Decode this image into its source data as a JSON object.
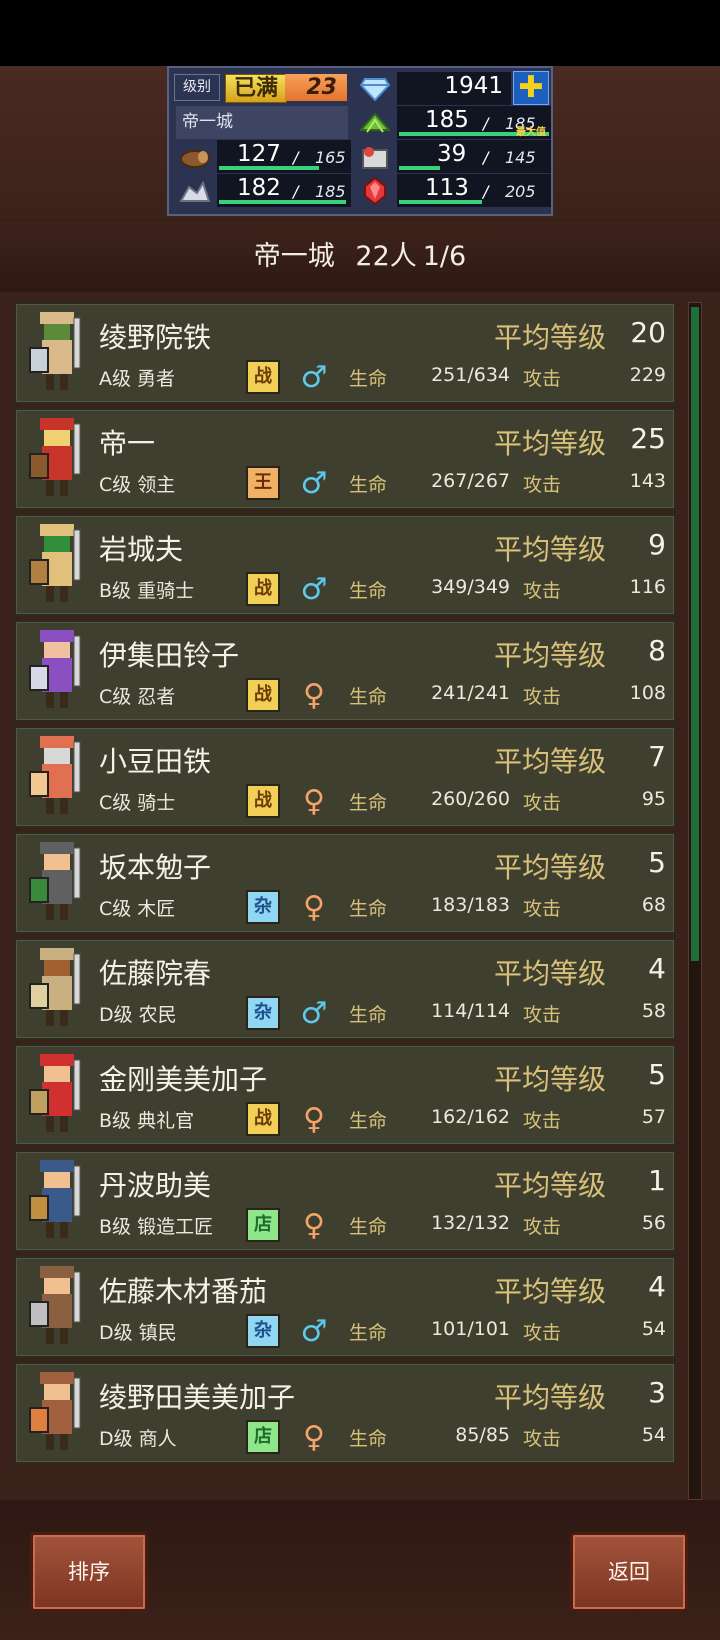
{
  "hud": {
    "level_label": "级别",
    "level_max": "已满",
    "level": "23",
    "gems": "1941",
    "city": "帝一城",
    "food": {
      "value": "185",
      "max": "185",
      "tag": "最大值",
      "fill": 1.0
    },
    "wood": {
      "value": "127",
      "max": "165",
      "fill": 0.77
    },
    "ore": {
      "value": "39",
      "max": "145",
      "fill": 0.27
    },
    "stone": {
      "value": "182",
      "max": "185",
      "fill": 0.98
    },
    "crystal": {
      "value": "113",
      "max": "205",
      "fill": 0.55
    },
    "sep": "/"
  },
  "title": {
    "city": "帝一城",
    "count": "22人",
    "page": "1/6"
  },
  "labels": {
    "avg": "平均等级",
    "hp": "生命",
    "atk": "攻击"
  },
  "units": [
    {
      "name": "绫野院铁",
      "avg": "20",
      "rank": "A级 勇者",
      "badge": "战",
      "badge_type": "zhan",
      "gender": "male",
      "hp": "251/634",
      "atk": "229"
    },
    {
      "name": "帝一",
      "avg": "25",
      "rank": "C级 领主",
      "badge": "王",
      "badge_type": "wang",
      "gender": "male",
      "hp": "267/267",
      "atk": "143"
    },
    {
      "name": "岩城夫",
      "avg": "9",
      "rank": "B级 重骑士",
      "badge": "战",
      "badge_type": "zhan",
      "gender": "male",
      "hp": "349/349",
      "atk": "116"
    },
    {
      "name": "伊集田铃子",
      "avg": "8",
      "rank": "C级 忍者",
      "badge": "战",
      "badge_type": "zhan",
      "gender": "female",
      "hp": "241/241",
      "atk": "108"
    },
    {
      "name": "小豆田铁",
      "avg": "7",
      "rank": "C级 骑士",
      "badge": "战",
      "badge_type": "zhan",
      "gender": "female",
      "hp": "260/260",
      "atk": "95"
    },
    {
      "name": "坂本勉子",
      "avg": "5",
      "rank": "C级 木匠",
      "badge": "杂",
      "badge_type": "za",
      "gender": "female",
      "hp": "183/183",
      "atk": "68"
    },
    {
      "name": "佐藤院春",
      "avg": "4",
      "rank": "D级 农民",
      "badge": "杂",
      "badge_type": "za",
      "gender": "male",
      "hp": "114/114",
      "atk": "58"
    },
    {
      "name": "金刚美美加子",
      "avg": "5",
      "rank": "B级 典礼官",
      "badge": "战",
      "badge_type": "zhan",
      "gender": "female",
      "hp": "162/162",
      "atk": "57"
    },
    {
      "name": "丹波助美",
      "avg": "1",
      "rank": "B级 锻造工匠",
      "badge": "店",
      "badge_type": "dian",
      "gender": "female",
      "hp": "132/132",
      "atk": "56"
    },
    {
      "name": "佐藤木材番茄",
      "avg": "4",
      "rank": "D级 镇民",
      "badge": "杂",
      "badge_type": "za",
      "gender": "male",
      "hp": "101/101",
      "atk": "54"
    },
    {
      "name": "绫野田美美加子",
      "avg": "3",
      "rank": "D级 商人",
      "badge": "店",
      "badge_type": "dian",
      "gender": "female",
      "hp": "85/85",
      "atk": "54"
    }
  ],
  "buttons": {
    "sort": "排序",
    "back": "返回"
  }
}
